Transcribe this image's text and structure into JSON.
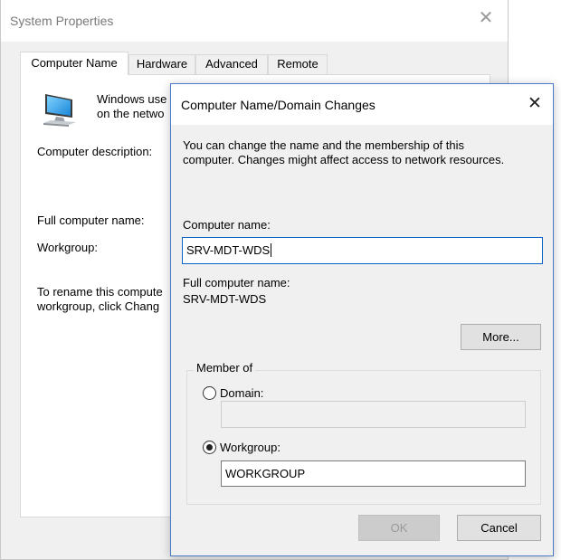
{
  "system_properties": {
    "title": "System Properties",
    "close_glyph": "✕",
    "tabs": [
      {
        "label": "Computer Name",
        "active": true
      },
      {
        "label": "Hardware",
        "active": false
      },
      {
        "label": "Advanced",
        "active": false
      },
      {
        "label": "Remote",
        "active": false
      }
    ],
    "intro_line1": "Windows use",
    "intro_line2": "on the netwo",
    "computer_description_label": "Computer description:",
    "full_computer_name_label": "Full computer name:",
    "workgroup_label": "Workgroup:",
    "rename_line1": "To rename this compute",
    "rename_line2": "workgroup, click Chang",
    "icon": "computer-monitor-icon"
  },
  "dialog": {
    "title": "Computer Name/Domain Changes",
    "close_glyph": "✕",
    "description_line1": "You can change the name and the membership of this",
    "description_line2": "computer. Changes might affect access to network resources.",
    "computer_name_label": "Computer name:",
    "computer_name_value": "SRV-MDT-WDS",
    "full_computer_name_label": "Full computer name:",
    "full_computer_name_value": "SRV-MDT-WDS",
    "more_button": "More...",
    "member_of_label": "Member of",
    "domain_label": "Domain:",
    "domain_value": "",
    "domain_selected": false,
    "workgroup_label": "Workgroup:",
    "workgroup_value": "WORKGROUP",
    "workgroup_selected": true,
    "ok_button": "OK",
    "cancel_button": "Cancel"
  },
  "colors": {
    "accent_border": "#4b7bc4",
    "focus_border": "#0a64c8",
    "window_bg": "#f0f0f0"
  }
}
